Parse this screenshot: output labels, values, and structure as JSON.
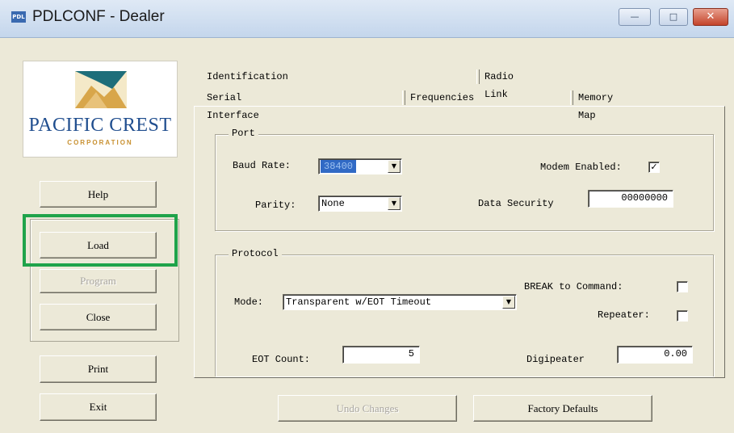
{
  "window": {
    "title": "PDLCONF - Dealer",
    "app_icon_text": "PDL",
    "controls": {
      "minimize": "—",
      "maximize": "□",
      "close": "✕"
    }
  },
  "logo": {
    "name": "PACIFIC CREST",
    "sub": "CORPORATION"
  },
  "left_buttons": {
    "help": "Help",
    "load": "Load",
    "program": "Program",
    "close": "Close",
    "print": "Print",
    "exit": "Exit"
  },
  "tabs": {
    "back_row": [
      "Identification",
      "Radio Link"
    ],
    "front_row": [
      "Serial Interface",
      "Frequencies",
      "Memory Map"
    ],
    "active": "Serial Interface"
  },
  "port": {
    "legend": "Port",
    "baud_rate_label": "Baud Rate:",
    "baud_rate_value": "38400",
    "parity_label": "Parity:",
    "parity_value": "None",
    "modem_enabled_label": "Modem Enabled:",
    "modem_enabled_checked": true,
    "modem_check_glyph": "✓",
    "data_security_label": "Data Security",
    "data_security_value": "00000000"
  },
  "protocol": {
    "legend": "Protocol",
    "mode_label": "Mode:",
    "mode_value": "Transparent w/EOT Timeout",
    "break_label": "BREAK to Command:",
    "break_checked": false,
    "repeater_label": "Repeater:",
    "repeater_checked": false,
    "eot_label": "EOT Count:",
    "eot_value": "5",
    "digipeater_label": "Digipeater",
    "digipeater_value": "0.00"
  },
  "bottom_buttons": {
    "undo": "Undo Changes",
    "factory": "Factory Defaults"
  },
  "colors": {
    "highlight": "#1fa34a",
    "selection": "#316ac5",
    "logo_blue": "#1f4d8e"
  }
}
